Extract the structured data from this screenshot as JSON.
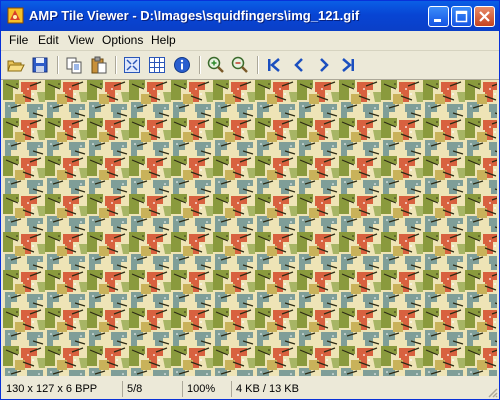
{
  "window": {
    "title": "AMP Tile Viewer - D:\\Images\\squidfingers\\img_121.gif"
  },
  "menu": {
    "file": "File",
    "edit": "Edit",
    "view": "View",
    "options": "Options",
    "help": "Help"
  },
  "toolbar_icons": [
    "open-folder-icon",
    "save-icon",
    "copy-icon",
    "paste-icon",
    "fit-window-icon",
    "grid-icon",
    "info-icon",
    "zoom-in-icon",
    "zoom-out-icon",
    "first-image-icon",
    "previous-image-icon",
    "next-image-icon",
    "last-image-icon"
  ],
  "status": {
    "dimensions": "130 x 127 x 6 BPP",
    "position": "5/8",
    "zoom": "100%",
    "size": "4 KB / 13 KB"
  },
  "colors": {
    "title_blue": "#0a4fd8",
    "tile_red": "#d8613f",
    "tile_teal": "#7f9e98",
    "tile_olive": "#8a9a3d",
    "tile_cream": "#eee4b6",
    "tile_dark": "#2c2a14"
  }
}
